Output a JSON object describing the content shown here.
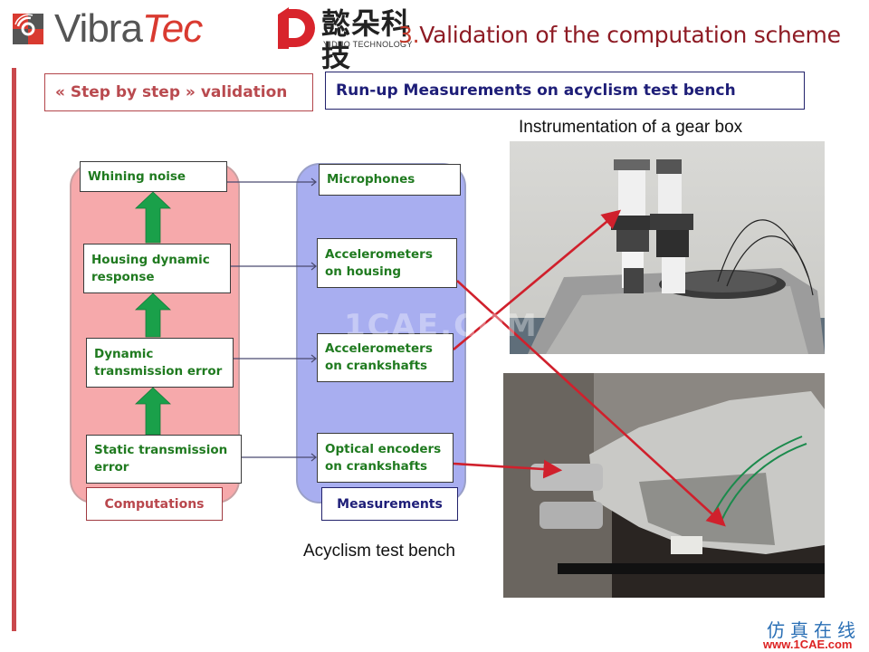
{
  "logos": {
    "vibratec": {
      "name_part1": "Vibra",
      "name_part2": "Tec"
    },
    "yiduo": {
      "chinese": "懿朵科技",
      "english": "YIDUO TECHNOLOGY"
    }
  },
  "title": {
    "number": "3.",
    "text": "Validation of the computation scheme"
  },
  "header": {
    "left_label": "« Step by step » validation",
    "right_label": "Run-up Measurements on acyclism test bench"
  },
  "captions": {
    "gear_box": "Instrumentation  of a gear box",
    "test_bench": "Acyclism  test bench"
  },
  "computations": {
    "label": "Computations",
    "nodes": [
      {
        "text": "Whining noise"
      },
      {
        "text": "Housing dynamic response"
      },
      {
        "text": "Dynamic transmission error"
      },
      {
        "text": "Static transmission error"
      }
    ]
  },
  "measurements": {
    "label": "Measurements",
    "nodes": [
      {
        "text": "Microphones"
      },
      {
        "text": "Accelerometers on housing"
      },
      {
        "text": "Accelerometers on crankshafts"
      },
      {
        "text": "Optical encoders on crankshafts"
      }
    ]
  },
  "colors": {
    "computations_panel": "#f6a9ab",
    "measurements_panel": "#a8aef0",
    "node_text": "#1f7a1f",
    "arrow_green": "#1aa04a",
    "pointer_red": "#d0202c",
    "title_red": "#8e1b24",
    "navy": "#1e1e78"
  },
  "watermark": {
    "overlay": "1CAE.COM",
    "chinese": "仿真在线",
    "url": "www.1CAE.com"
  }
}
